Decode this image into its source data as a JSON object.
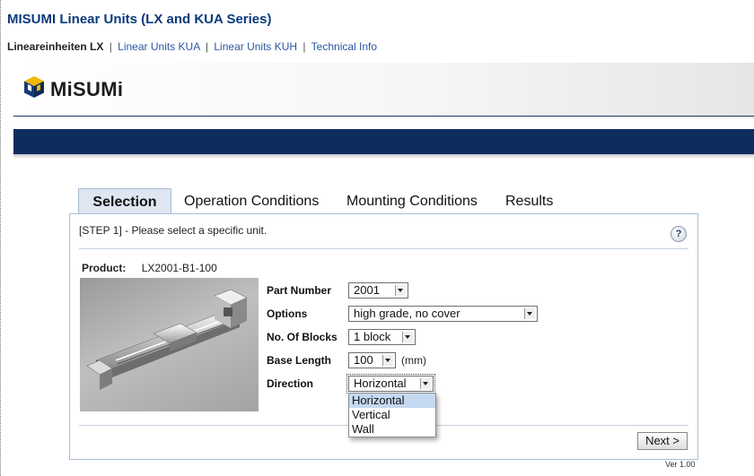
{
  "page": {
    "title": "MISUMI Linear Units (LX and KUA Series)",
    "subnav": {
      "current": "Lineareinheiten LX",
      "links": [
        "Linear Units KUA",
        "Linear Units KUH",
        "Technical Info"
      ],
      "separator": "|"
    }
  },
  "header": {
    "logo_text": "MiSUMi",
    "logo_icon": "misumi-cube-icon",
    "bar_color": "#0d2d5e"
  },
  "tabs": [
    {
      "label": "Selection",
      "active": true
    },
    {
      "label": "Operation Conditions",
      "active": false
    },
    {
      "label": "Mounting Conditions",
      "active": false
    },
    {
      "label": "Results",
      "active": false
    }
  ],
  "step": {
    "text": "[STEP 1] - Please select a specific unit.",
    "help_icon": "help-icon",
    "help_glyph": "?"
  },
  "product": {
    "label": "Product:",
    "value": "LX2001-B1-100"
  },
  "form": {
    "part_number": {
      "label": "Part Number",
      "value": "2001"
    },
    "options": {
      "label": "Options",
      "value": "high grade, no cover"
    },
    "blocks": {
      "label": "No. Of Blocks",
      "value": "1 block"
    },
    "base_length": {
      "label": "Base Length",
      "value": "100",
      "unit": "(mm)"
    },
    "direction": {
      "label": "Direction",
      "value": "Horizontal",
      "options": [
        "Horizontal",
        "Vertical",
        "Wall"
      ]
    }
  },
  "next_button": {
    "label": "Next >"
  },
  "version": "Ver 1.00",
  "colors": {
    "title": "#0b3a7b",
    "link": "#2a56a3",
    "tab_active_bg": "#dde6f1",
    "panel_border": "#a6bdd6",
    "dropdown_highlight": "#c5d9f1"
  }
}
